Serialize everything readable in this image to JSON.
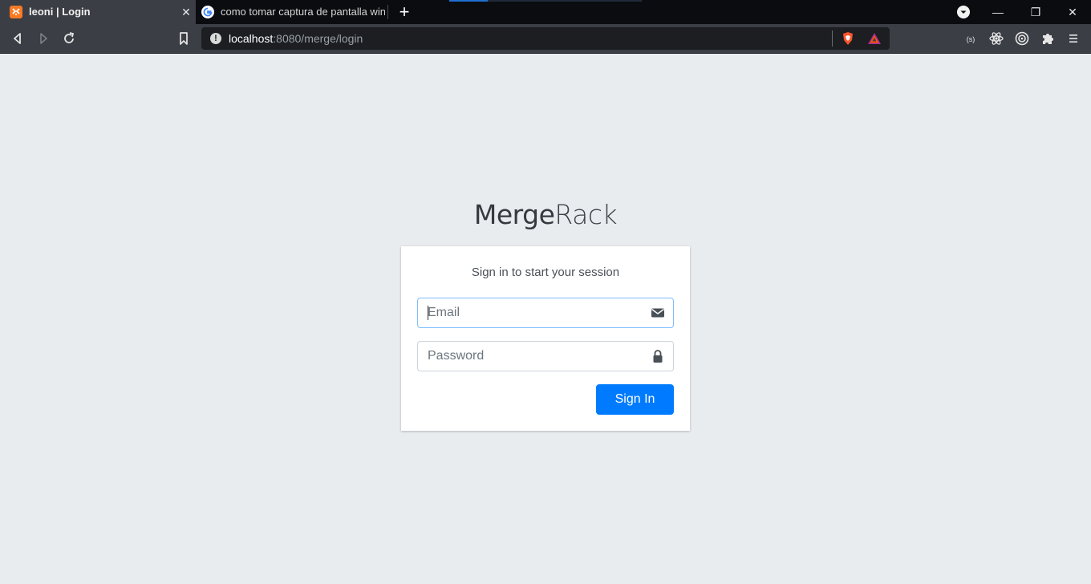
{
  "browser": {
    "tabs": [
      {
        "title": "leoni | Login",
        "active": true,
        "favicon": "xampp-icon"
      },
      {
        "title": "como tomar captura de pantalla windo",
        "active": false,
        "favicon": "google-icon"
      }
    ],
    "close_glyph": "✕",
    "new_tab_glyph": "+",
    "window_controls": {
      "minimize": "—",
      "restore": "❐",
      "close": "✕"
    },
    "address": {
      "host": "localhost",
      "rest": ":8080/merge/login"
    },
    "toolbar_icons": [
      "back-icon",
      "forward-icon",
      "reload-icon",
      "bookmark-icon",
      "brave-shields-icon",
      "brave-rewards-icon",
      "extension-s-icon",
      "react-devtools-icon",
      "target-icon",
      "extensions-puzzle-icon",
      "menu-icon"
    ],
    "colors": {
      "tabbar": "#0b0c10",
      "toolbar": "#3b3e45",
      "urlbar": "#1c1e22"
    }
  },
  "page": {
    "logo": {
      "bold": "Merge",
      "light": "Rack"
    },
    "login_message": "Sign in to start your session",
    "email": {
      "placeholder": "Email",
      "value": ""
    },
    "password": {
      "placeholder": "Password",
      "value": ""
    },
    "signin_label": "Sign In",
    "colors": {
      "background": "#e9ecef",
      "primary": "#007bff",
      "card": "#ffffff"
    }
  }
}
